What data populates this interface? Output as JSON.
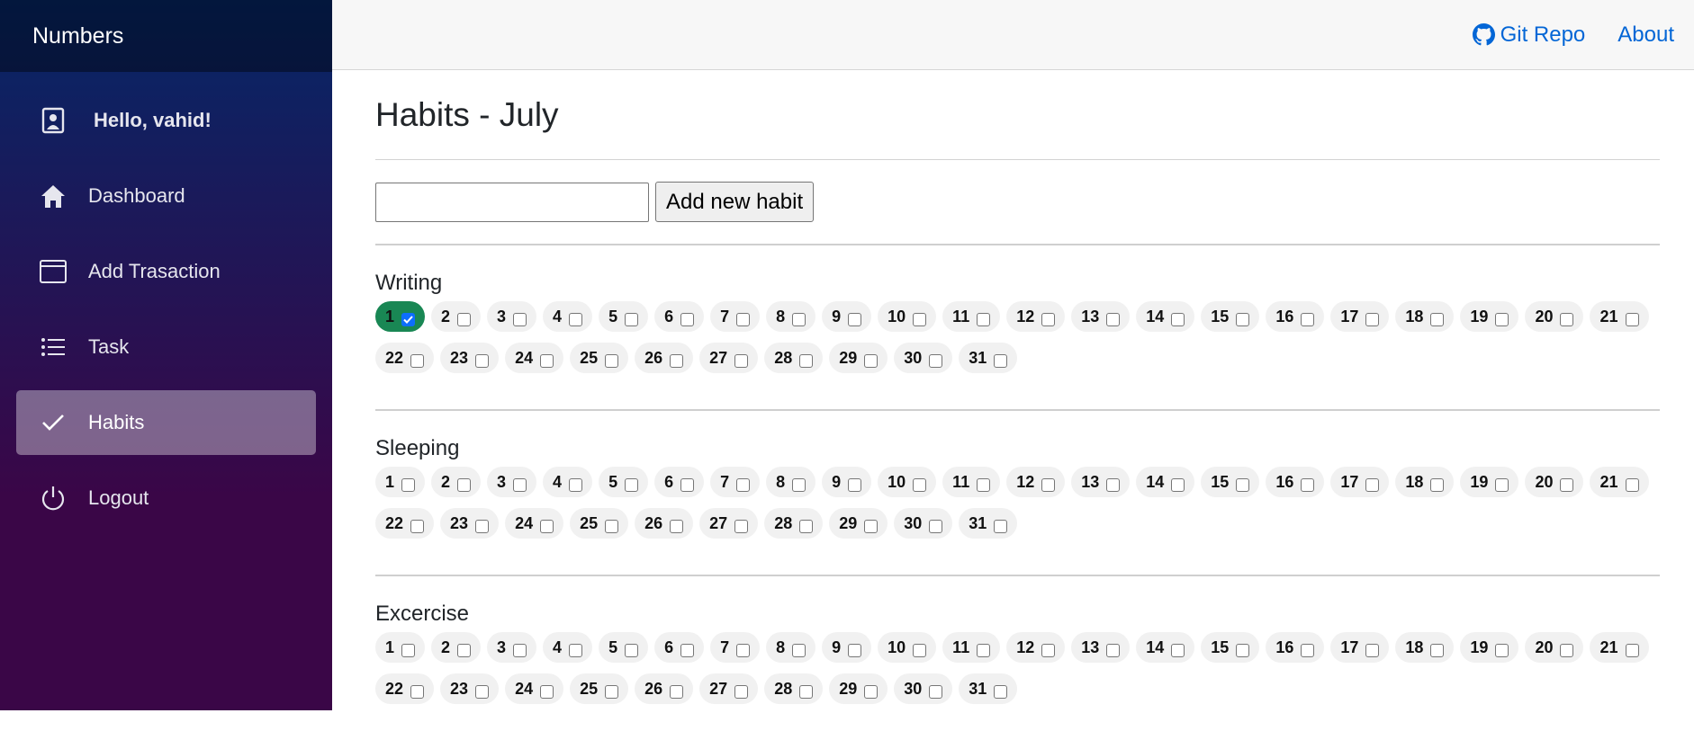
{
  "app": {
    "brand": "Numbers"
  },
  "sidebar": {
    "items": [
      {
        "label": "Hello, vahid!",
        "icon": "user-icon"
      },
      {
        "label": "Dashboard",
        "icon": "home-icon"
      },
      {
        "label": "Add Trasaction",
        "icon": "window-icon"
      },
      {
        "label": "Task",
        "icon": "list-icon"
      },
      {
        "label": "Habits",
        "icon": "check-icon",
        "active": true
      },
      {
        "label": "Logout",
        "icon": "power-icon"
      }
    ]
  },
  "topbar": {
    "git_repo": "Git Repo",
    "about": "About",
    "link_color": "#0366d6"
  },
  "page": {
    "title": "Habits - July"
  },
  "add_habit": {
    "input_value": "",
    "button_label": "Add new habit"
  },
  "habits": [
    {
      "name": "Writing",
      "checked_days": [
        1
      ]
    },
    {
      "name": "Sleeping",
      "checked_days": []
    },
    {
      "name": "Excercise",
      "checked_days": []
    }
  ],
  "days": [
    "1",
    "2",
    "3",
    "4",
    "5",
    "6",
    "7",
    "8",
    "9",
    "10",
    "11",
    "12",
    "13",
    "14",
    "15",
    "16",
    "17",
    "18",
    "19",
    "20",
    "21",
    "22",
    "23",
    "24",
    "25",
    "26",
    "27",
    "28",
    "29",
    "30",
    "31"
  ],
  "colors": {
    "checked_pill": "#198754",
    "checkbox_checked": "#0d6efd",
    "sidebar_top": "#052767",
    "sidebar_bottom": "#3a0647"
  }
}
